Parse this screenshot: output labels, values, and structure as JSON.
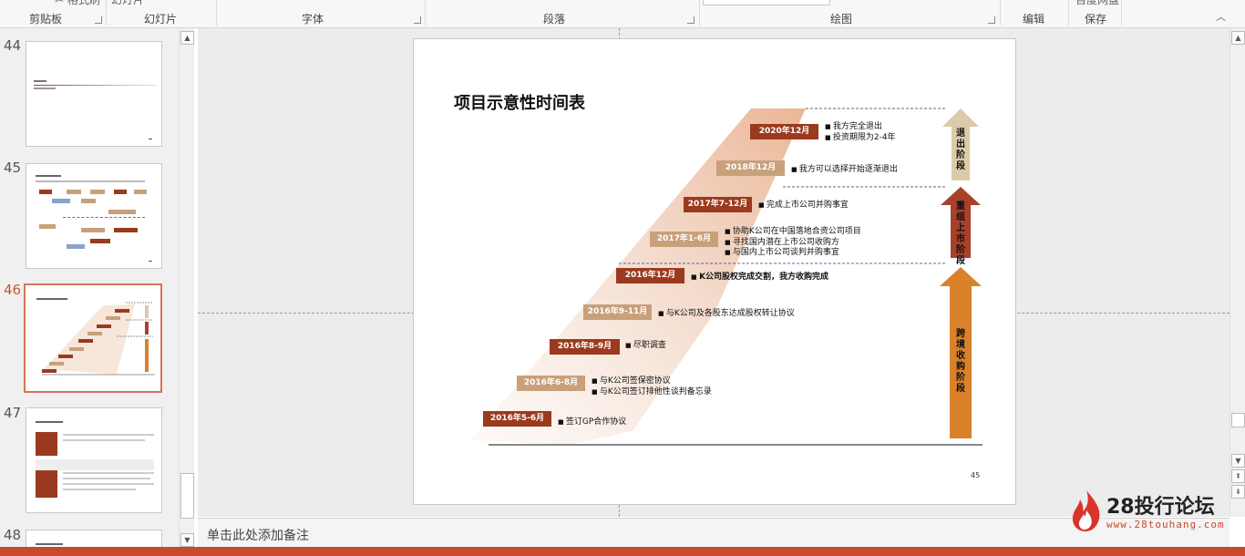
{
  "ribbon": {
    "groups": [
      {
        "label": "剪贴板"
      },
      {
        "label": "幻灯片"
      },
      {
        "label": "字体"
      },
      {
        "label": "段落"
      },
      {
        "label": "绘图"
      },
      {
        "label": "编辑"
      },
      {
        "label": "保存"
      }
    ],
    "top_cut": {
      "slides": "幻灯片",
      "save": "百度网盘"
    }
  },
  "thumbnails": [
    {
      "number": "44",
      "selected": false
    },
    {
      "number": "45",
      "selected": false
    },
    {
      "number": "46",
      "selected": true
    },
    {
      "number": "47",
      "selected": false
    },
    {
      "number": "48",
      "selected": false
    }
  ],
  "notes": {
    "placeholder": "单击此处添加备注"
  },
  "slide": {
    "title": "项目示意性时间表",
    "page_number": "45",
    "timeline": [
      {
        "date": "2016年5-6月",
        "color": "#9b3a1e",
        "bullets": [
          "签订GP合作协议"
        ]
      },
      {
        "date": "2016年6-8月",
        "color": "#c8a07a",
        "bullets": [
          "与K公司签保密协议",
          "与K公司签订排他性谈判备忘录"
        ]
      },
      {
        "date": "2016年8-9月",
        "color": "#9b3a1e",
        "bullets": [
          "尽职调查"
        ]
      },
      {
        "date": "2016年9-11月",
        "color": "#c8a07a",
        "bullets": [
          "与K公司及各股东达成股权转让协议"
        ]
      },
      {
        "date": "2016年12月",
        "color": "#9b3a1e",
        "bullets": [
          "K公司股权完成交割，我方收购完成"
        ]
      },
      {
        "date": "2017年1-6月",
        "color": "#c8a07a",
        "bullets": [
          "协助K公司在中国落地合资公司项目",
          "寻找国内潜在上市公司收购方",
          "与国内上市公司谈判并购事宜"
        ]
      },
      {
        "date": "2017年7-12月",
        "color": "#9b3a1e",
        "bullets": [
          "完成上市公司并购事宜"
        ]
      },
      {
        "date": "2018年12月",
        "color": "#c8a07a",
        "bullets": [
          "我方可以选择开始逐渐退出"
        ]
      },
      {
        "date": "2020年12月",
        "color": "#9b3a1e",
        "bullets": [
          "我方完全退出",
          "投资期限为2-4年"
        ]
      }
    ],
    "phases": [
      {
        "label": "退出阶段",
        "color": "#dccba8"
      },
      {
        "label": "重组上市阶段",
        "color": "#a8402a"
      },
      {
        "label": "跨境收购阶段",
        "color": "#d9822b"
      }
    ]
  },
  "logo": {
    "text": "28投行论坛",
    "url": "www.28touhang.com"
  }
}
